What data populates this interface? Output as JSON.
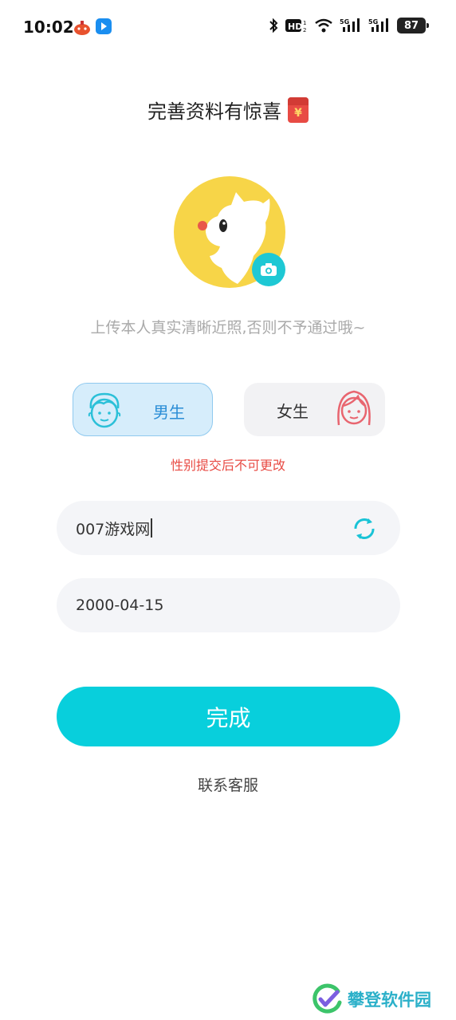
{
  "status_bar": {
    "time": "10:02",
    "battery": "87",
    "app_icons": [
      "notification-app-icon",
      "bilibili-app-icon"
    ],
    "right_icons": [
      "bluetooth-icon",
      "hd-icon",
      "wifi-icon",
      "signal-5g-icon",
      "signal-5g-icon"
    ]
  },
  "header": {
    "title": "完善资料有惊喜",
    "title_icon": "red-packet-icon",
    "red_packet_symbol": "¥"
  },
  "avatar": {
    "badge_icon": "camera-icon",
    "hint": "上传本人真实清晰近照,否则不予通过哦~"
  },
  "gender": {
    "male_label": "男生",
    "female_label": "女生",
    "selected": "male",
    "warning": "性别提交后不可更改"
  },
  "form": {
    "nickname_value": "007游戏网",
    "birthday_value": "2000-04-15"
  },
  "actions": {
    "done_label": "完成",
    "contact_label": "联系客服"
  },
  "watermark": {
    "text": "攀登软件园"
  },
  "colors": {
    "accent": "#08cfdc",
    "male_bg": "#d6edfb",
    "female_icon": "#e8656f",
    "male_icon": "#2bc0d8",
    "warning": "#e84b44",
    "avatar_yellow": "#f7d548"
  }
}
